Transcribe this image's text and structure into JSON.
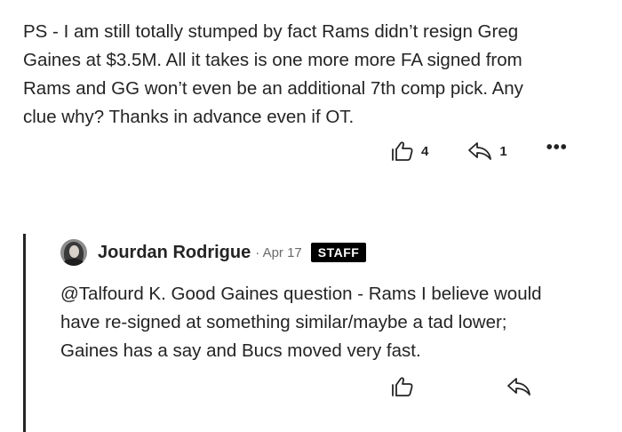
{
  "parent_comment": {
    "text": "PS - I am still totally stumped by fact Rams didn’t resign Greg\nGaines at $3.5M. All it takes is one more more FA signed from\nRams and GG won’t even be an additional 7th comp pick. Any\nclue why? Thanks in advance even if OT.",
    "claps": "4",
    "replies": "1",
    "more_label": "•••"
  },
  "reply": {
    "author": "Jourdan Rodrigue",
    "date": "· Apr 17",
    "badge": "STAFF",
    "text": "@Talfourd K. Good Gaines question - Rams I believe would\nhave re-signed at something similar/maybe a tad lower;\nGaines has a say and Bucs moved very fast."
  },
  "icons": {
    "clap": "clap-icon",
    "reply": "reply-arrow-icon",
    "more": "more-options-icon"
  },
  "colors": {
    "text": "#242424",
    "muted": "#6b6b6b",
    "badge_bg": "#000000",
    "thread_line": "#242424"
  }
}
